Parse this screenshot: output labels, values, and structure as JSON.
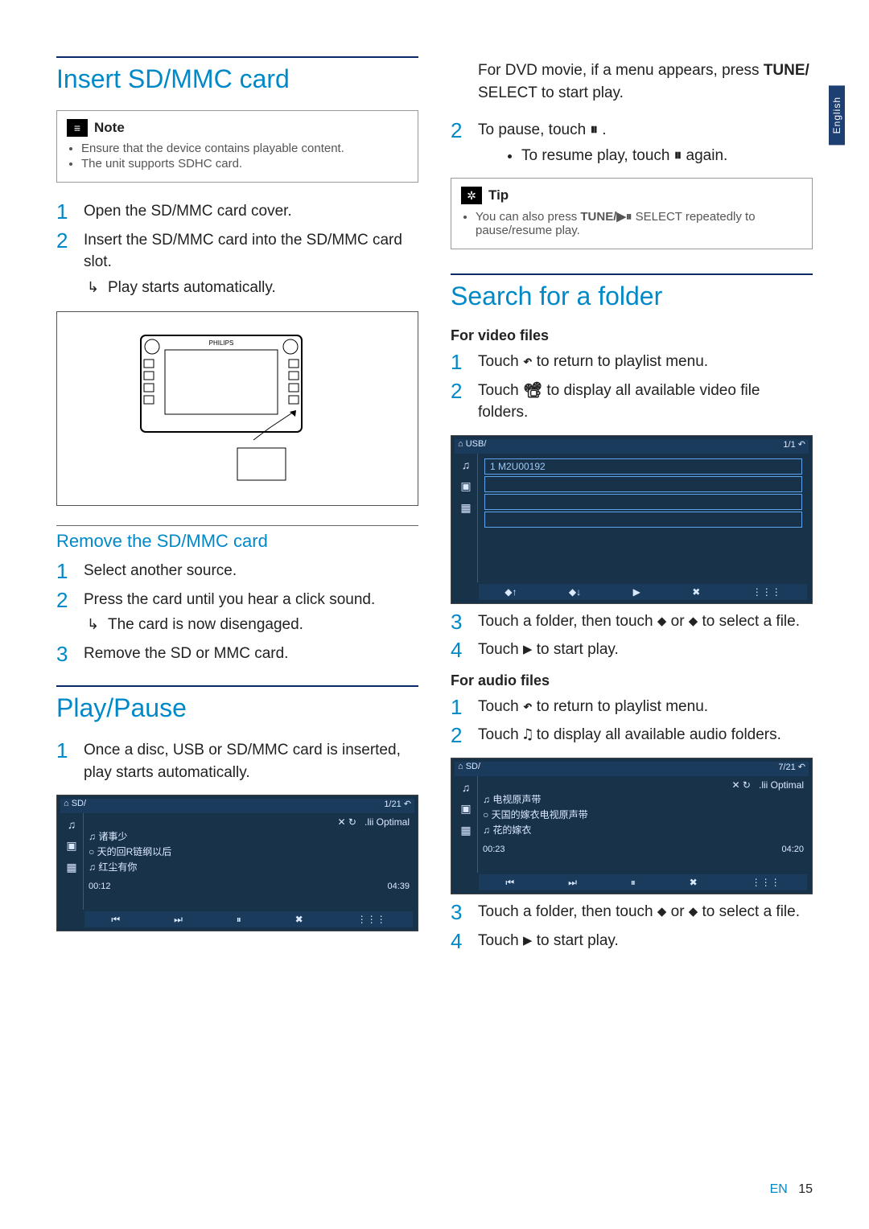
{
  "lang_tab": "English",
  "footer": {
    "lang": "EN",
    "page": "15"
  },
  "left": {
    "section1": {
      "title": "Insert SD/MMC card",
      "note": {
        "label": "Note",
        "items": [
          "Ensure that the device contains playable content.",
          "The unit supports SDHC card."
        ]
      },
      "steps": [
        "Open the SD/MMC card cover.",
        "Insert the SD/MMC card into the SD/MMC card slot."
      ],
      "result": "Play starts automatically.",
      "figure_label": "PHILIPS"
    },
    "section2": {
      "title": "Remove the SD/MMC card",
      "steps": [
        "Select another source.",
        "Press the card until you hear a click sound.",
        "Remove the SD or MMC card."
      ],
      "result_after_step2": "The card is now disengaged."
    },
    "section3": {
      "title": "Play/Pause",
      "steps": [
        "Once a disc, USB or SD/MMC card is inserted, play starts automatically."
      ],
      "screenshot": {
        "top_left": "SD/",
        "top_right": "1/21 ↶",
        "track_label": ".lii Optimal",
        "rows": [
          "♫ 诸事少",
          "○ 天的回R链纲以后",
          "♫ 红尘有你"
        ],
        "time_left": "00:12",
        "time_right": "04:39",
        "controls": [
          "⏮",
          "⏭",
          "⏸",
          "✖",
          "⋮⋮⋮"
        ]
      }
    }
  },
  "right": {
    "intro": {
      "line1_a": "For DVD movie, if a menu appears, press ",
      "line1_b": "TUNE/",
      "line1_c": " SELECT to start play."
    },
    "pause": {
      "step_pre": "To pause, touch ",
      "step_icon": "⏸",
      "step_post": " .",
      "bullet_pre": "To resume play, touch ",
      "bullet_icon": "⏸",
      "bullet_post": " again."
    },
    "tip": {
      "label": "Tip",
      "text_a": "You can also press ",
      "text_b": "TUNE/▶⏸",
      "text_c": " SELECT repeatedly to pause/resume play."
    },
    "section_search": {
      "title": "Search for a folder",
      "video": {
        "heading": "For video files",
        "step1_a": "Touch ",
        "step1_icon": "↶",
        "step1_b": " to return to playlist menu.",
        "step2_a": "Touch ",
        "step2_icon": "📽",
        "step2_b": " to display all available video file folders.",
        "screenshot": {
          "top_left": "USB/",
          "top_right": "1/1 ↶",
          "folder": "1  M2U00192",
          "controls": [
            "◆↑",
            "◆↓",
            "▶",
            "✖",
            "⋮⋮⋮"
          ]
        },
        "step3_a": "Touch a folder, then touch ",
        "step3_up": "◆",
        "step3_mid": " or ",
        "step3_dn": "◆",
        "step3_b": " to select a file.",
        "step4_a": "Touch ",
        "step4_icon": "▶",
        "step4_b": " to start play."
      },
      "audio": {
        "heading": "For audio files",
        "step1_a": "Touch ",
        "step1_icon": "↶",
        "step1_b": " to return to playlist menu.",
        "step2_a": "Touch ",
        "step2_icon": "♫",
        "step2_b": " to display all available audio folders.",
        "screenshot": {
          "top_left": "SD/",
          "top_right": "7/21 ↶",
          "track_label": ".lii Optimal",
          "rows": [
            "♫ 电视原声带",
            "○ 天国的嫁衣电视原声带",
            "♫ 花的嫁衣"
          ],
          "time_left": "00:23",
          "time_right": "04:20",
          "controls": [
            "⏮",
            "⏭",
            "⏸",
            "✖",
            "⋮⋮⋮"
          ]
        },
        "step3_a": "Touch a folder, then touch ",
        "step3_up": "◆",
        "step3_mid": " or ",
        "step3_dn": "◆",
        "step3_b": " to select a file.",
        "step4_a": "Touch ",
        "step4_icon": "▶",
        "step4_b": " to start play."
      }
    }
  }
}
